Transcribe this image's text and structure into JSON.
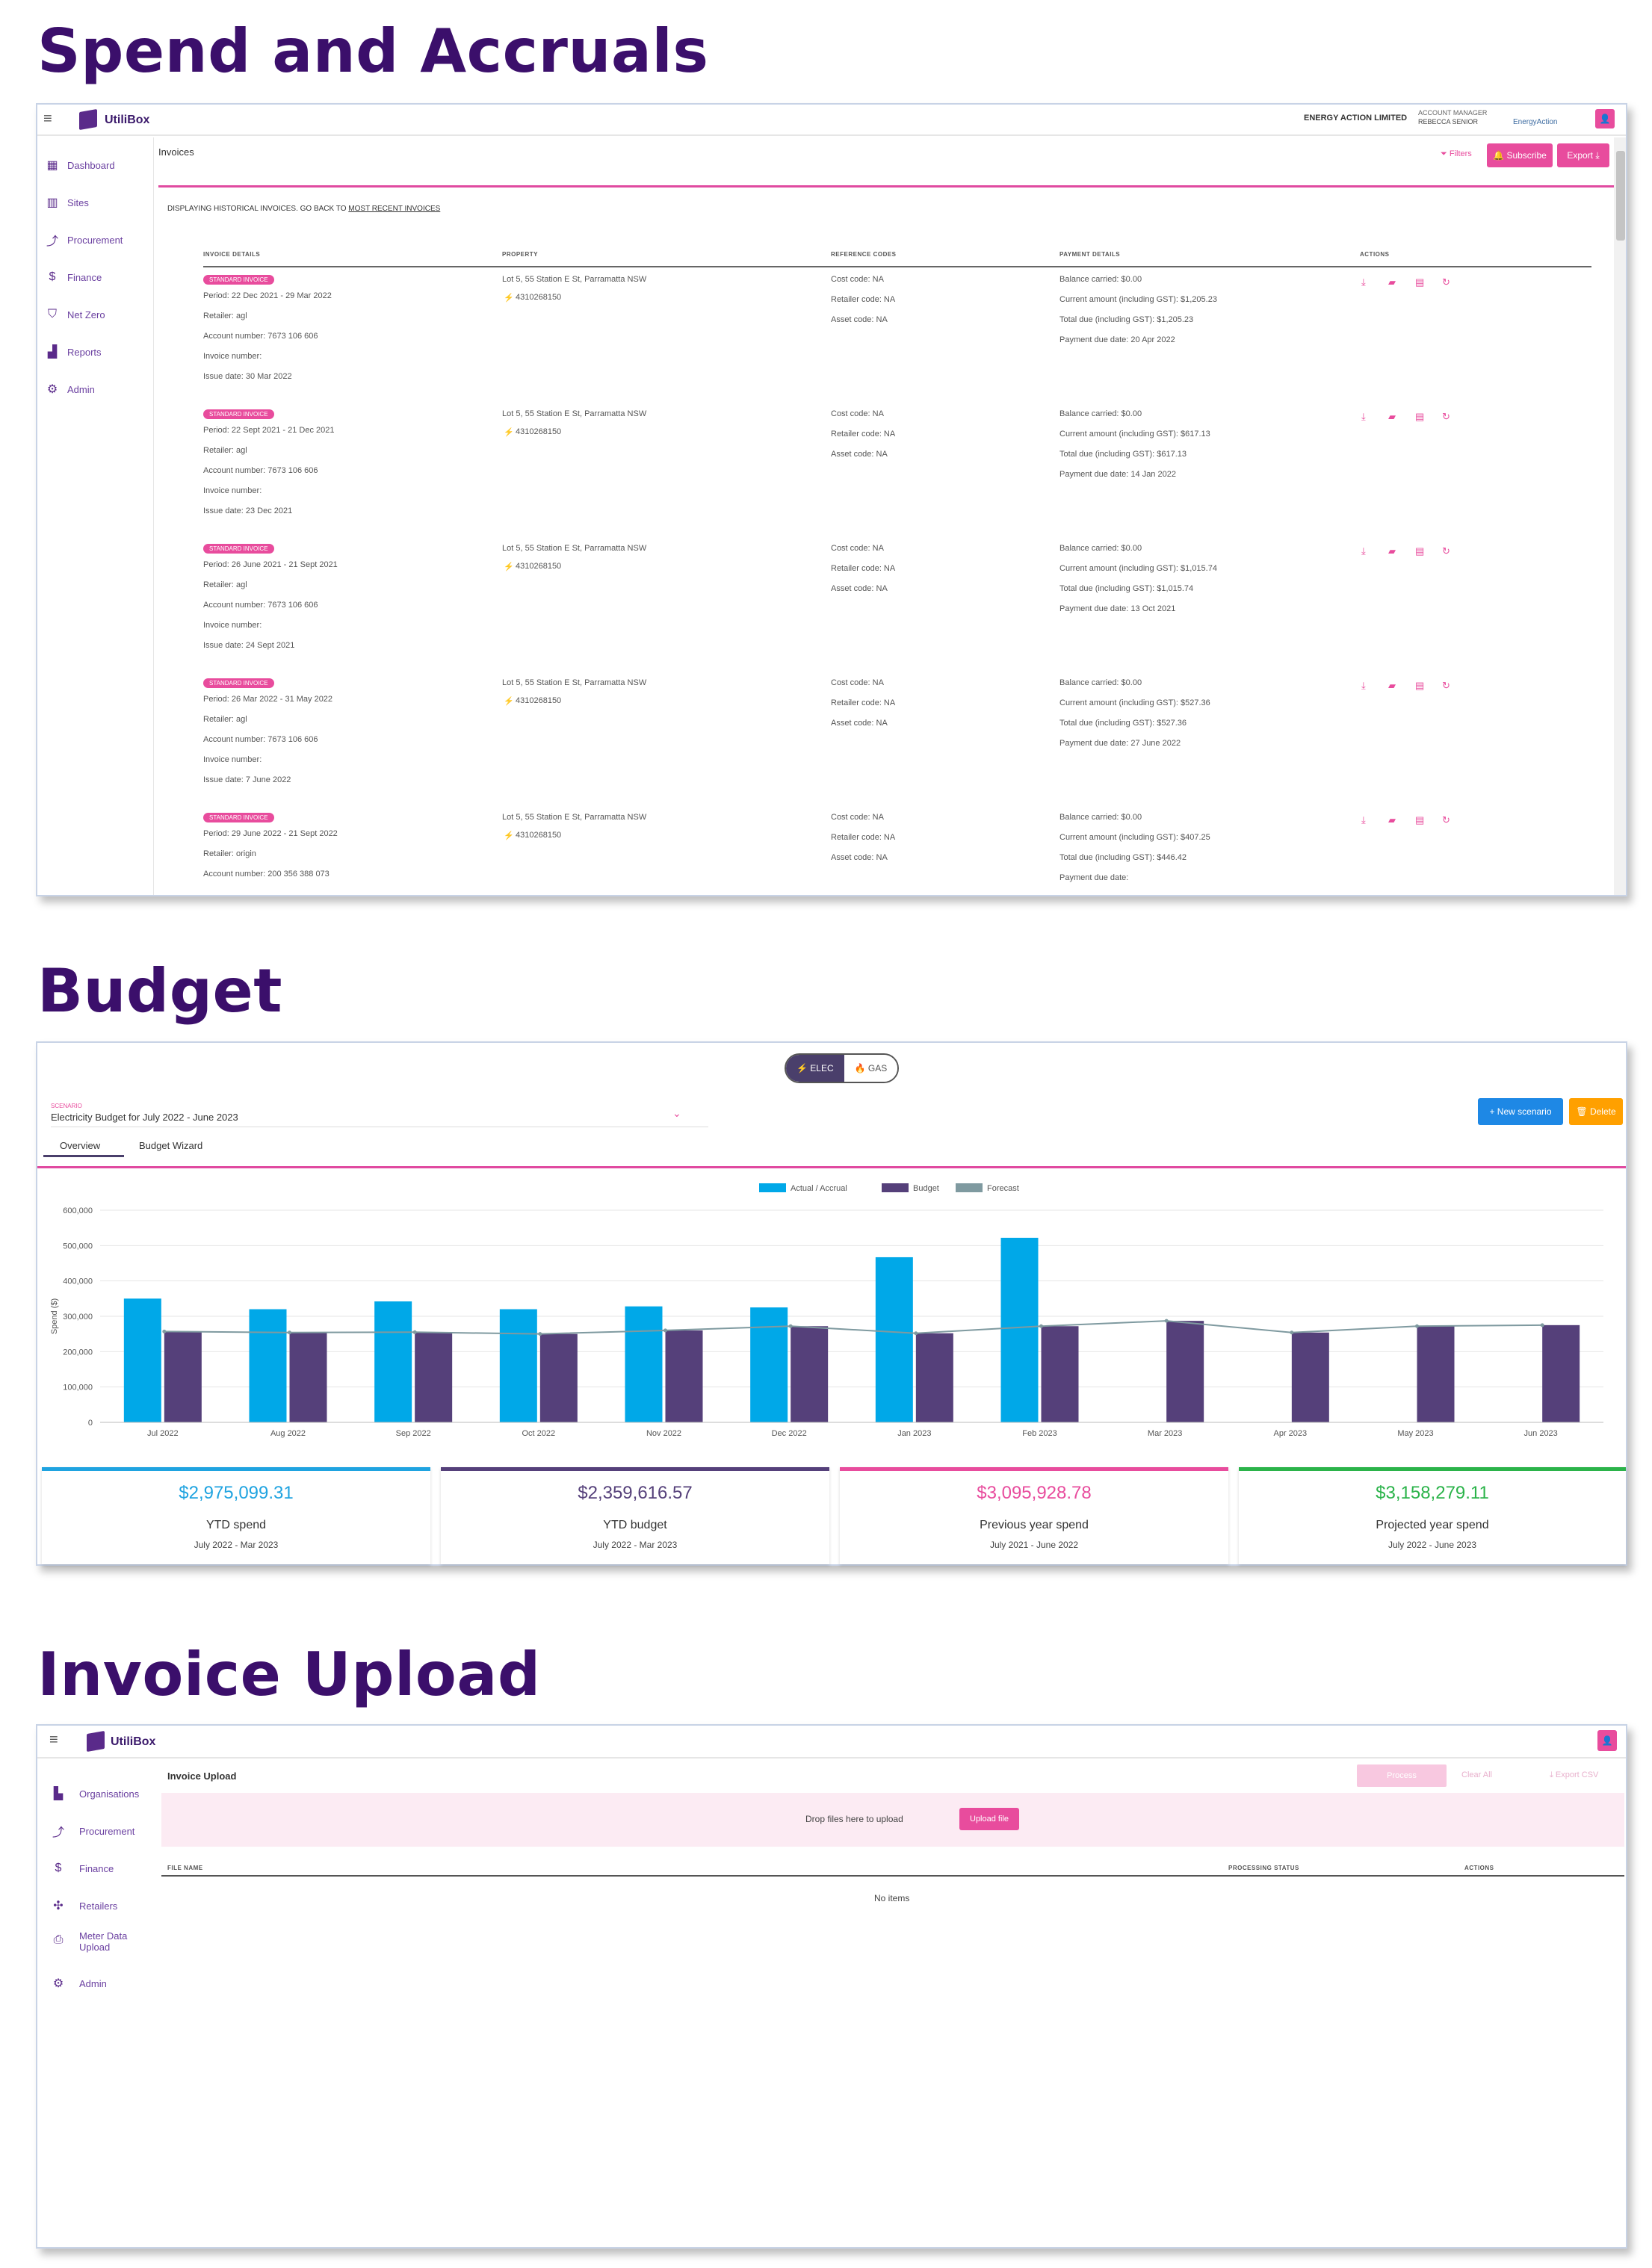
{
  "sections": {
    "spend_title": "Spend and Accruals",
    "budget_title": "Budget",
    "upload_title": "Invoice Upload"
  },
  "spend": {
    "app_name": "UtiliBox",
    "company": "ENERGY ACTION LIMITED",
    "account_manager_label": "ACCOUNT MANAGER",
    "account_manager_name": "REBECCA SENIOR",
    "brand": "EnergyAction",
    "page_title": "Invoices",
    "filters_label": "Filters",
    "subscribe_label": "Subscribe",
    "export_label": "Export",
    "notice_prefix": "DISPLAYING HISTORICAL INVOICES. GO BACK TO",
    "notice_link": "MOST RECENT INVOICES",
    "sidebar": [
      "Dashboard",
      "Sites",
      "Procurement",
      "Finance",
      "Net Zero",
      "Reports",
      "Admin"
    ],
    "columns": [
      "INVOICE DETAILS",
      "PROPERTY",
      "REFERENCE CODES",
      "PAYMENT DETAILS",
      "ACTIONS"
    ],
    "rows": [
      {
        "badge": "STANDARD INVOICE",
        "period": "Period: 22 Dec 2021 - 29 Mar 2022",
        "retailer": "Retailer: agl",
        "account": "Account number: 7673 106 606",
        "invoice_no": "Invoice number:",
        "issue": "Issue date: 30 Mar 2022",
        "property": "Lot 5, 55 Station E St, Parramatta NSW",
        "nmi": "4310268150",
        "cost_code": "Cost code: NA",
        "retailer_code": "Retailer code: NA",
        "asset_code": "Asset code: NA",
        "balance": "Balance carried: $0.00",
        "current": "Current amount (including GST): $1,205.23",
        "total": "Total due (including GST): $1,205.23",
        "due": "Payment due date: 20 Apr 2022"
      },
      {
        "badge": "STANDARD INVOICE",
        "period": "Period: 22 Sept 2021 - 21 Dec 2021",
        "retailer": "Retailer: agl",
        "account": "Account number: 7673 106 606",
        "invoice_no": "Invoice number:",
        "issue": "Issue date: 23 Dec 2021",
        "property": "Lot 5, 55 Station E St, Parramatta NSW",
        "nmi": "4310268150",
        "cost_code": "Cost code: NA",
        "retailer_code": "Retailer code: NA",
        "asset_code": "Asset code: NA",
        "balance": "Balance carried: $0.00",
        "current": "Current amount (including GST): $617.13",
        "total": "Total due (including GST): $617.13",
        "due": "Payment due date: 14 Jan 2022"
      },
      {
        "badge": "STANDARD INVOICE",
        "period": "Period: 26 June 2021 - 21 Sept 2021",
        "retailer": "Retailer: agl",
        "account": "Account number: 7673 106 606",
        "invoice_no": "Invoice number:",
        "issue": "Issue date: 24 Sept 2021",
        "property": "Lot 5, 55 Station E St, Parramatta NSW",
        "nmi": "4310268150",
        "cost_code": "Cost code: NA",
        "retailer_code": "Retailer code: NA",
        "asset_code": "Asset code: NA",
        "balance": "Balance carried: $0.00",
        "current": "Current amount (including GST): $1,015.74",
        "total": "Total due (including GST): $1,015.74",
        "due": "Payment due date: 13 Oct 2021"
      },
      {
        "badge": "STANDARD INVOICE",
        "period": "Period: 26 Mar 2022 - 31 May 2022",
        "retailer": "Retailer: agl",
        "account": "Account number: 7673 106 606",
        "invoice_no": "Invoice number:",
        "issue": "Issue date: 7 June 2022",
        "property": "Lot 5, 55 Station E St, Parramatta NSW",
        "nmi": "4310268150",
        "cost_code": "Cost code: NA",
        "retailer_code": "Retailer code: NA",
        "asset_code": "Asset code: NA",
        "balance": "Balance carried: $0.00",
        "current": "Current amount (including GST): $527.36",
        "total": "Total due (including GST): $527.36",
        "due": "Payment due date: 27 June 2022"
      },
      {
        "badge": "STANDARD INVOICE",
        "period": "Period: 29 June 2022 - 21 Sept 2022",
        "retailer": "Retailer: origin",
        "account": "Account number: 200 356 388 073",
        "invoice_no": "",
        "issue": "",
        "property": "Lot 5, 55 Station E St, Parramatta NSW",
        "nmi": "4310268150",
        "cost_code": "Cost code: NA",
        "retailer_code": "Retailer code: NA",
        "asset_code": "Asset code: NA",
        "balance": "Balance carried: $0.00",
        "current": "Current amount (including GST): $407.25",
        "total": "Total due (including GST): $446.42",
        "due": "Payment due date:"
      }
    ]
  },
  "budget": {
    "toggle_elec": "ELEC",
    "toggle_gas": "GAS",
    "scenario_label": "SCENARIO",
    "scenario_value": "Electricity Budget for July 2022 - June 2023",
    "new_scenario": "+ New scenario",
    "delete_label": "Delete",
    "tabs": [
      "Overview",
      "Budget Wizard"
    ],
    "kpis": [
      {
        "value": "$2,975,099.31",
        "label": "YTD spend",
        "sub": "July 2022 - Mar 2023",
        "color": "#1fa3e0"
      },
      {
        "value": "$2,359,616.57",
        "label": "YTD budget",
        "sub": "July 2022 - Mar 2023",
        "color": "#55407a"
      },
      {
        "value": "$3,095,928.78",
        "label": "Previous year spend",
        "sub": "July 2021 - June 2022",
        "color": "#e84c9d"
      },
      {
        "value": "$3,158,279.11",
        "label": "Projected year spend",
        "sub": "July 2022 - June 2023",
        "color": "#2bb34a"
      }
    ]
  },
  "chart_data": {
    "type": "bar",
    "categories": [
      "Jul 2022",
      "Aug 2022",
      "Sep 2022",
      "Oct 2022",
      "Nov 2022",
      "Dec 2022",
      "Jan 2023",
      "Feb 2023",
      "Mar 2023",
      "Apr 2023",
      "May 2023",
      "Jun 2023"
    ],
    "series": [
      {
        "name": "Actual / Accrual",
        "type": "bar",
        "color": "#00a8e8",
        "values": [
          350000,
          320000,
          342000,
          320000,
          328000,
          325000,
          467000,
          522000,
          null,
          null,
          null,
          null
        ]
      },
      {
        "name": "Budget",
        "type": "bar",
        "color": "#55407a",
        "values": [
          257000,
          254000,
          255000,
          250000,
          260000,
          272000,
          252000,
          272000,
          287000,
          254000,
          272000,
          275000
        ]
      },
      {
        "name": "Forecast",
        "type": "line",
        "color": "#7f9aa0",
        "values": [
          257000,
          254000,
          255000,
          250000,
          260000,
          272000,
          252000,
          272000,
          287000,
          254000,
          272000,
          275000
        ]
      }
    ],
    "ylabel": "Spend ($)",
    "ylim": [
      0,
      600000
    ],
    "yticks": [
      "0",
      "100,000",
      "200,000",
      "300,000",
      "400,000",
      "500,000",
      "600,000"
    ],
    "grid": true,
    "legend": "top-center"
  },
  "upload": {
    "app_name": "UtiliBox",
    "page_title": "Invoice Upload",
    "process_label": "Process",
    "clear_label": "Clear All",
    "export_label": "Export CSV",
    "drop_text": "Drop files here to upload",
    "upload_button": "Upload file",
    "columns": [
      "FILE NAME",
      "PROCESSING STATUS",
      "ACTIONS"
    ],
    "empty": "No items",
    "sidebar": [
      "Organisations",
      "Procurement",
      "Finance",
      "Retailers",
      "Meter Data",
      "Upload",
      "Admin"
    ]
  }
}
